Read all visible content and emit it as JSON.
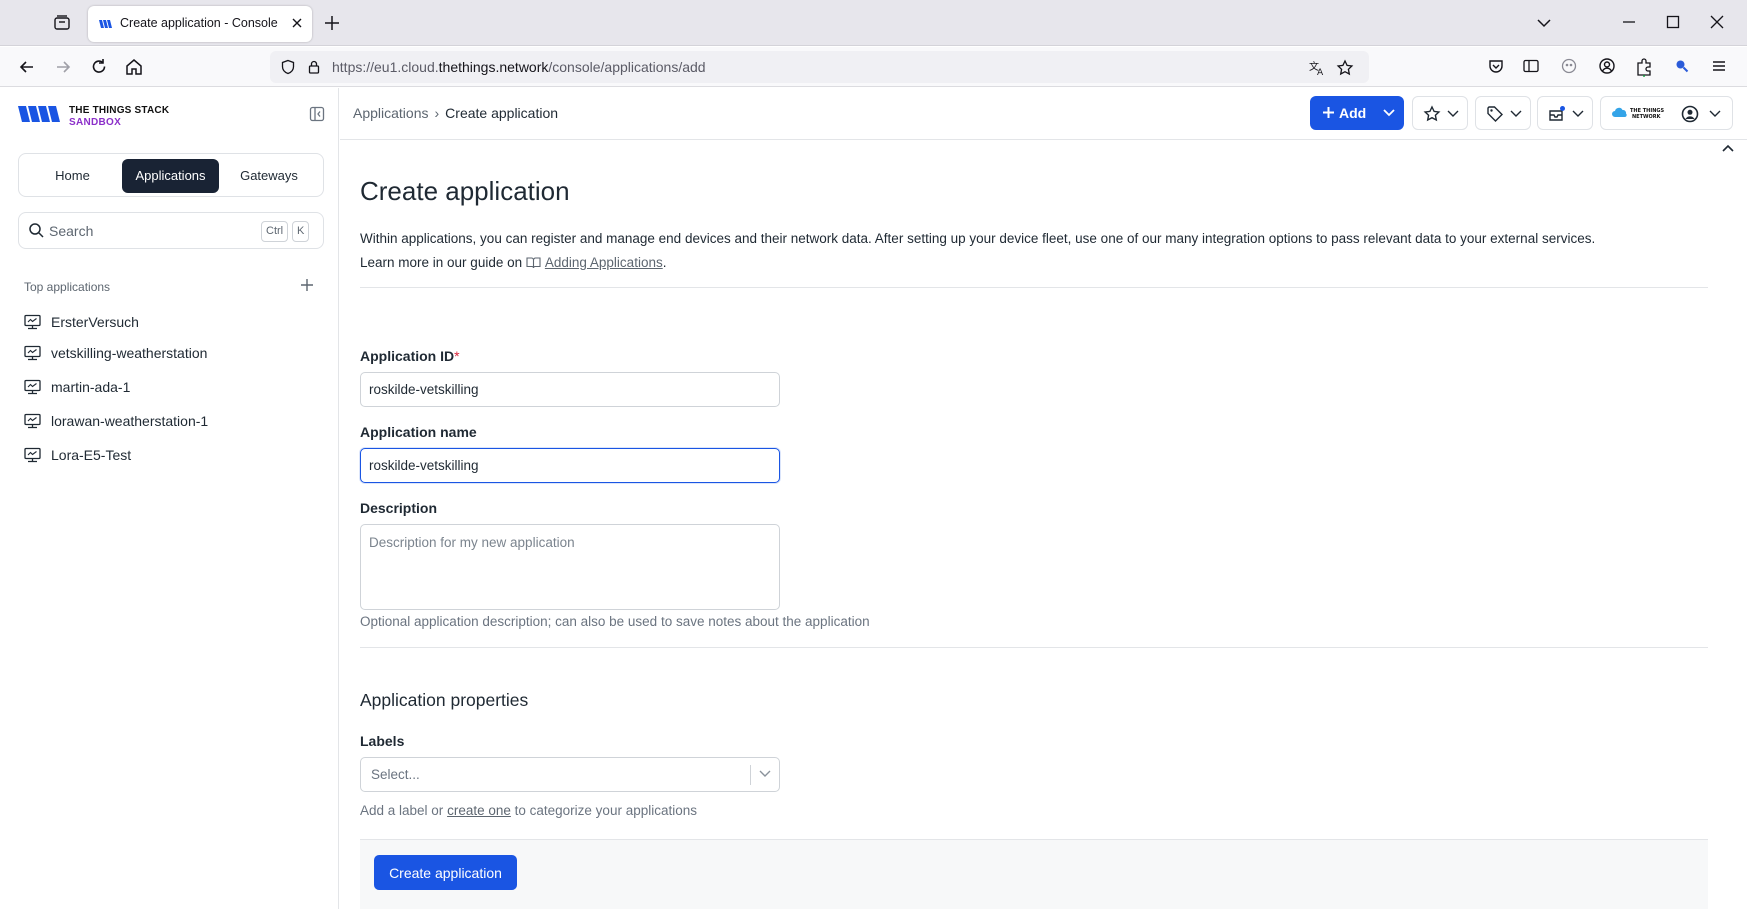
{
  "browser": {
    "tab_title": "Create application - Console - T",
    "url": {
      "prefix": "https://eu1.cloud.",
      "host": "thethings.network",
      "path": "/console/applications/add"
    }
  },
  "sidebar": {
    "logo": {
      "line1": "THE THINGS STACK",
      "line2": "SANDBOX"
    },
    "nav": [
      {
        "label": "Home",
        "active": false
      },
      {
        "label": "Applications",
        "active": true
      },
      {
        "label": "Gateways",
        "active": false
      }
    ],
    "search": {
      "placeholder": "Search",
      "shortcut_ctrl": "Ctrl",
      "shortcut_key": "K"
    },
    "top_apps_label": "Top applications",
    "apps": [
      {
        "label": "ErsterVersuch"
      },
      {
        "label": "vetskilling-weatherstation"
      },
      {
        "label": "martin-ada-1"
      },
      {
        "label": "lorawan-weatherstation-1"
      },
      {
        "label": "Lora-E5-Test"
      }
    ]
  },
  "header": {
    "breadcrumb": {
      "parent": "Applications",
      "current": "Create application"
    },
    "add_label": "Add",
    "accent": "#1a55e3"
  },
  "main": {
    "title": "Create application",
    "intro_line1": "Within applications, you can register and manage end devices and their network data. After setting up your device fleet, use one of our many integration options to pass relevant data to your external services.",
    "intro_line2_prefix": "Learn more in our guide on",
    "intro_link": "Adding Applications",
    "intro_line2_suffix": ".",
    "fields": {
      "app_id": {
        "label": "Application ID",
        "required_mark": "*",
        "value": "roskilde-vetskilling"
      },
      "app_name": {
        "label": "Application name",
        "value": "roskilde-vetskilling"
      },
      "description": {
        "label": "Description",
        "placeholder": "Description for my new application",
        "help": "Optional application description; can also be used to save notes about the application"
      }
    },
    "properties_title": "Application properties",
    "labels": {
      "label": "Labels",
      "placeholder": "Select...",
      "help_prefix": "Add a label or",
      "help_link": "create one",
      "help_suffix": "to categorize your applications"
    },
    "submit_label": "Create application"
  },
  "icons": {
    "favicon": "ttn-logo-icon",
    "header_avatar": "user-circle-icon"
  }
}
